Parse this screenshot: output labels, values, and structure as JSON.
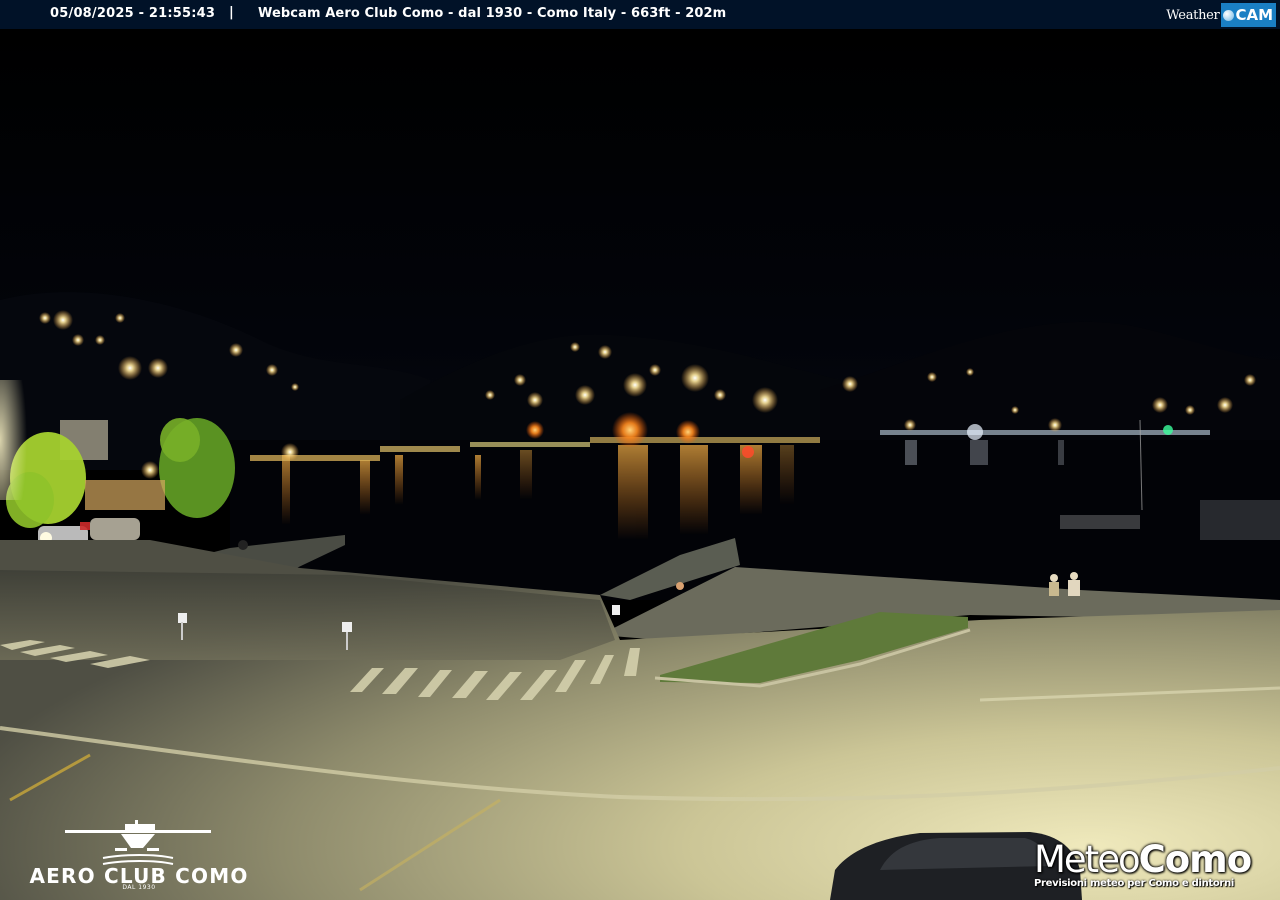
{
  "overlay": {
    "timestamp": "05/08/2025 - 21:55:43",
    "separator": "|",
    "caption": "Webcam  Aero Club Como - dal 1930 - Como Italy - 663ft - 202m"
  },
  "brand": {
    "weathercam_weather": "Weather",
    "weathercam_cam": "CAM",
    "aeroclub_name": "AERO CLUB COMO",
    "aeroclub_since": "DAL 1930",
    "meteocomo_meteo": "Meteo",
    "meteocomo_como": "Como",
    "meteocomo_tagline": "Previsioni meteo per Como e dintorni"
  },
  "colors": {
    "topbar": "#011228",
    "sky": "#000000",
    "lights": "#ffcf6a",
    "road_lit": "#d9d3a2",
    "weathercam_accent": "#1a7fc4"
  }
}
